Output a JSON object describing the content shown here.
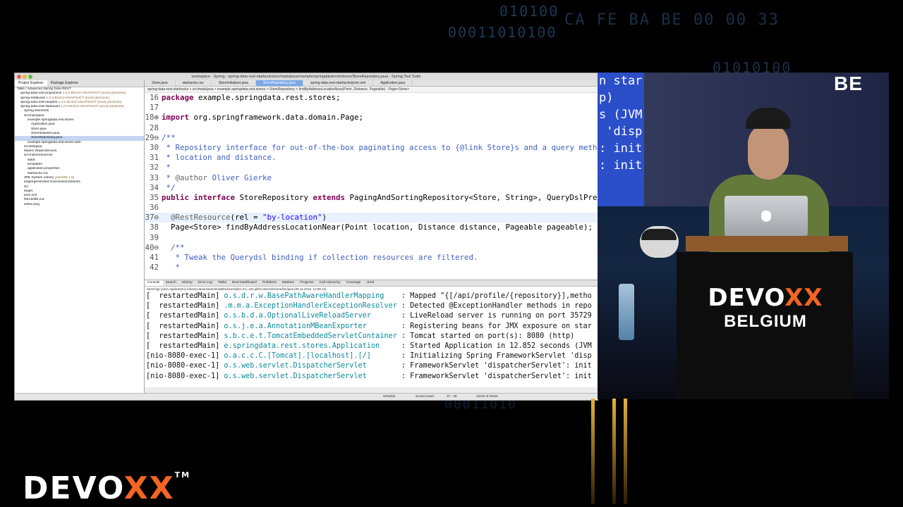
{
  "background": {
    "hex_lines": [
      "010100",
      "00011010100",
      "CA FE BA BE 00 00 33",
      "01010100",
      "00011010"
    ]
  },
  "ide": {
    "window_title": "workspace - Spring - spring-data-rest-starbucks/src/main/java/example/springdata/rest/stores/StoreRepository.java - Spring Tool Suite",
    "left_tabs": [
      "Project Explorer",
      "Package Explorer"
    ],
    "tree": [
      {
        "text": "Talks / Advanced Spring Data REST",
        "decoration": "",
        "selected": false
      },
      {
        "text": "spring-data-rest-projections",
        "decoration": "1.0.0.BUILD-SNAPSHOT [boot] [devtools]",
        "selected": false
      },
      {
        "text": "spring-restbucks",
        "decoration": "1.0.0.BUILD-SNAPSHOT [boot] [devtools]",
        "selected": false
      },
      {
        "text": "spring-data-rest-headers",
        "decoration": "1.0.0.BUILD-SNAPSHOT [boot] [devtools]",
        "selected": false
      },
      {
        "text": "spring-data-rest-starbucks",
        "decoration": "1.0.0.BUILD-SNAPSHOT [boot] [devtools]",
        "selected": false
      },
      {
        "text": "Spring Elements",
        "decoration": "",
        "selected": false
      },
      {
        "text": "src/main/java",
        "decoration": "",
        "selected": false
      },
      {
        "text": "example.springdata.rest.stores",
        "decoration": "",
        "selected": false
      },
      {
        "text": "Application.java",
        "decoration": "",
        "selected": false
      },
      {
        "text": "Store.java",
        "decoration": "",
        "selected": false
      },
      {
        "text": "StoreInitializer.java",
        "decoration": "",
        "selected": false
      },
      {
        "text": "StoreRepository.java",
        "decoration": "",
        "selected": true
      },
      {
        "text": "example.springdata.rest.stores.web",
        "decoration": "",
        "selected": false
      },
      {
        "text": "src/test/java",
        "decoration": "",
        "selected": false
      },
      {
        "text": "Maven Dependencies",
        "decoration": "",
        "selected": false
      },
      {
        "text": "src/main/resources",
        "decoration": "",
        "selected": false
      },
      {
        "text": "static",
        "decoration": "",
        "selected": false
      },
      {
        "text": "templates",
        "decoration": "",
        "selected": false
      },
      {
        "text": "application.properties",
        "decoration": "",
        "selected": false
      },
      {
        "text": "starbucks.csv",
        "decoration": "",
        "selected": false
      },
      {
        "text": "JRE System Library",
        "decoration": "[JavaSE-1.8]",
        "selected": false
      },
      {
        "text": "target/generated-sources/annotations",
        "decoration": "",
        "selected": false
      },
      {
        "text": "src",
        "decoration": "",
        "selected": false
      },
      {
        "text": "target",
        "decoration": "",
        "selected": false
      },
      {
        "text": "pom.xml",
        "decoration": "",
        "selected": false
      },
      {
        "text": "README.md",
        "decoration": "",
        "selected": false
      },
      {
        "text": "webui.png",
        "decoration": "",
        "selected": false
      }
    ],
    "editor_tabs": [
      "Store.java",
      "starbucks.csv",
      "StoreInitializer.java",
      "StoreRepository.java",
      "spring-data-rest-starbucks/pom.xml",
      "Application.java"
    ],
    "active_editor_tab": 3,
    "breadcrumb": "spring-data-rest-starbucks > src/main/java > example.springdata.rest.stores > StoreRepository > findByAddressLocationNear(Point, Distance, Pageable) : Page<Store>",
    "code_lines": [
      {
        "num": "16",
        "parts": [
          {
            "t": "package ",
            "c": "kw"
          },
          {
            "t": "example.springdata.rest.stores;",
            "c": ""
          }
        ]
      },
      {
        "num": "17",
        "parts": []
      },
      {
        "num": "18⊕",
        "parts": [
          {
            "t": "import ",
            "c": "kw"
          },
          {
            "t": "org.springframework.data.domain.Page;",
            "c": ""
          }
        ]
      },
      {
        "num": "28",
        "parts": []
      },
      {
        "num": "29⊖",
        "parts": [
          {
            "t": "/**",
            "c": "cm"
          }
        ]
      },
      {
        "num": "30",
        "parts": [
          {
            "t": " * Repository interface for out-of-the-box paginating access to {@link Store}s and a query method",
            "c": "cm"
          }
        ]
      },
      {
        "num": "31",
        "parts": [
          {
            "t": " * location and distance.",
            "c": "cm"
          }
        ]
      },
      {
        "num": "32",
        "parts": [
          {
            "t": " *",
            "c": "cm"
          }
        ]
      },
      {
        "num": "33",
        "parts": [
          {
            "t": " * ",
            "c": "cm"
          },
          {
            "t": "@author",
            "c": "an"
          },
          {
            "t": " Oliver Gierke",
            "c": "cm"
          }
        ]
      },
      {
        "num": "34",
        "parts": [
          {
            "t": " */",
            "c": "cm"
          }
        ]
      },
      {
        "num": "35",
        "parts": [
          {
            "t": "public interface ",
            "c": "kw"
          },
          {
            "t": "StoreRepository ",
            "c": ""
          },
          {
            "t": "extends ",
            "c": "kw"
          },
          {
            "t": "PagingAndSortingRepository<Store, String>, QueryDslPredic",
            "c": ""
          }
        ]
      },
      {
        "num": "36",
        "parts": []
      },
      {
        "num": "37⊖",
        "parts": [
          {
            "t": "  @RestResource",
            "c": "an"
          },
          {
            "t": "(rel = ",
            "c": ""
          },
          {
            "t": "\"by-location\"",
            "c": "st"
          },
          {
            "t": ")",
            "c": ""
          }
        ],
        "highlight": true
      },
      {
        "num": "38",
        "parts": [
          {
            "t": "  Page<Store> findByAddressLocationNear(Point location, Distance distance, Pageable pageable);",
            "c": ""
          }
        ]
      },
      {
        "num": "39",
        "parts": []
      },
      {
        "num": "40⊖",
        "parts": [
          {
            "t": "  /**",
            "c": "cm"
          }
        ]
      },
      {
        "num": "41",
        "parts": [
          {
            "t": "   * Tweak the Querydsl binding if collection resources are filtered.",
            "c": "cm"
          }
        ]
      },
      {
        "num": "42",
        "parts": [
          {
            "t": "   *",
            "c": "cm"
          }
        ]
      }
    ],
    "console_tabs": [
      "Console",
      "Search",
      "History",
      "Error Log",
      "Tasks",
      "Boot Dashboard",
      "Problems",
      "Markers",
      "Progress",
      "Call Hierarchy",
      "Coverage",
      "JUnit"
    ],
    "console_path": "StoreApp [Java Application] /Library/Java/JavaVirtualMachines/jdk1.8.0_102.jdk/Contents/Home/bin/java (09.11.2016, 12:08:13)",
    "log_lines": [
      {
        "thread": "[  restartedMain]",
        "logger": "o.s.d.r.w.BasePathAwareHandlerMapping",
        "msg": ": Mapped \"{[/api/profile/{repository}],metho"
      },
      {
        "thread": "[  restartedMain]",
        "logger": ".m.m.a.ExceptionHandlerExceptionResolver",
        "msg": ": Detected @ExceptionHandler methods in repo"
      },
      {
        "thread": "[  restartedMain]",
        "logger": "o.s.b.d.a.OptionalLiveReloadServer",
        "msg": ": LiveReload server is running on port 35729"
      },
      {
        "thread": "[  restartedMain]",
        "logger": "o.s.j.e.a.AnnotationMBeanExporter",
        "msg": ": Registering beans for JMX exposure on star"
      },
      {
        "thread": "[  restartedMain]",
        "logger": "s.b.c.e.t.TomcatEmbeddedServletContainer",
        "msg": ": Tomcat started on port(s): 8080 (http)"
      },
      {
        "thread": "[  restartedMain]",
        "logger": "e.springdata.rest.stores.Application",
        "msg": ": Started Application in 12.852 seconds (JVM"
      },
      {
        "thread": "[nio-8080-exec-1]",
        "logger": "o.a.c.c.C.[Tomcat].[localhost].[/]",
        "msg": ": Initializing Spring FrameworkServlet 'disp"
      },
      {
        "thread": "[nio-8080-exec-1]",
        "logger": "o.s.web.servlet.DispatcherServlet",
        "msg": ": FrameworkServlet 'dispatcherServlet': init"
      },
      {
        "thread": "[nio-8080-exec-1]",
        "logger": "o.s.web.servlet.DispatcherServlet",
        "msg": ": FrameworkServlet 'dispatcherServlet': init"
      }
    ],
    "status": {
      "writable": "Writable",
      "insert": "Smart Insert",
      "position": "37 : 35",
      "memory": "181M of 281M"
    }
  },
  "stage": {
    "screen_fragment_lines": [
      "n star",
      "p)",
      "s (JVM",
      " 'disp",
      ": init",
      ": init"
    ],
    "screen_brand": "BE",
    "podium_brand_prefix": "DEVO",
    "podium_brand_xx": "XX",
    "podium_sub": "BELGIUM"
  },
  "logo": {
    "prefix": "DEVO",
    "xx": "XX",
    "tm": "TM"
  }
}
